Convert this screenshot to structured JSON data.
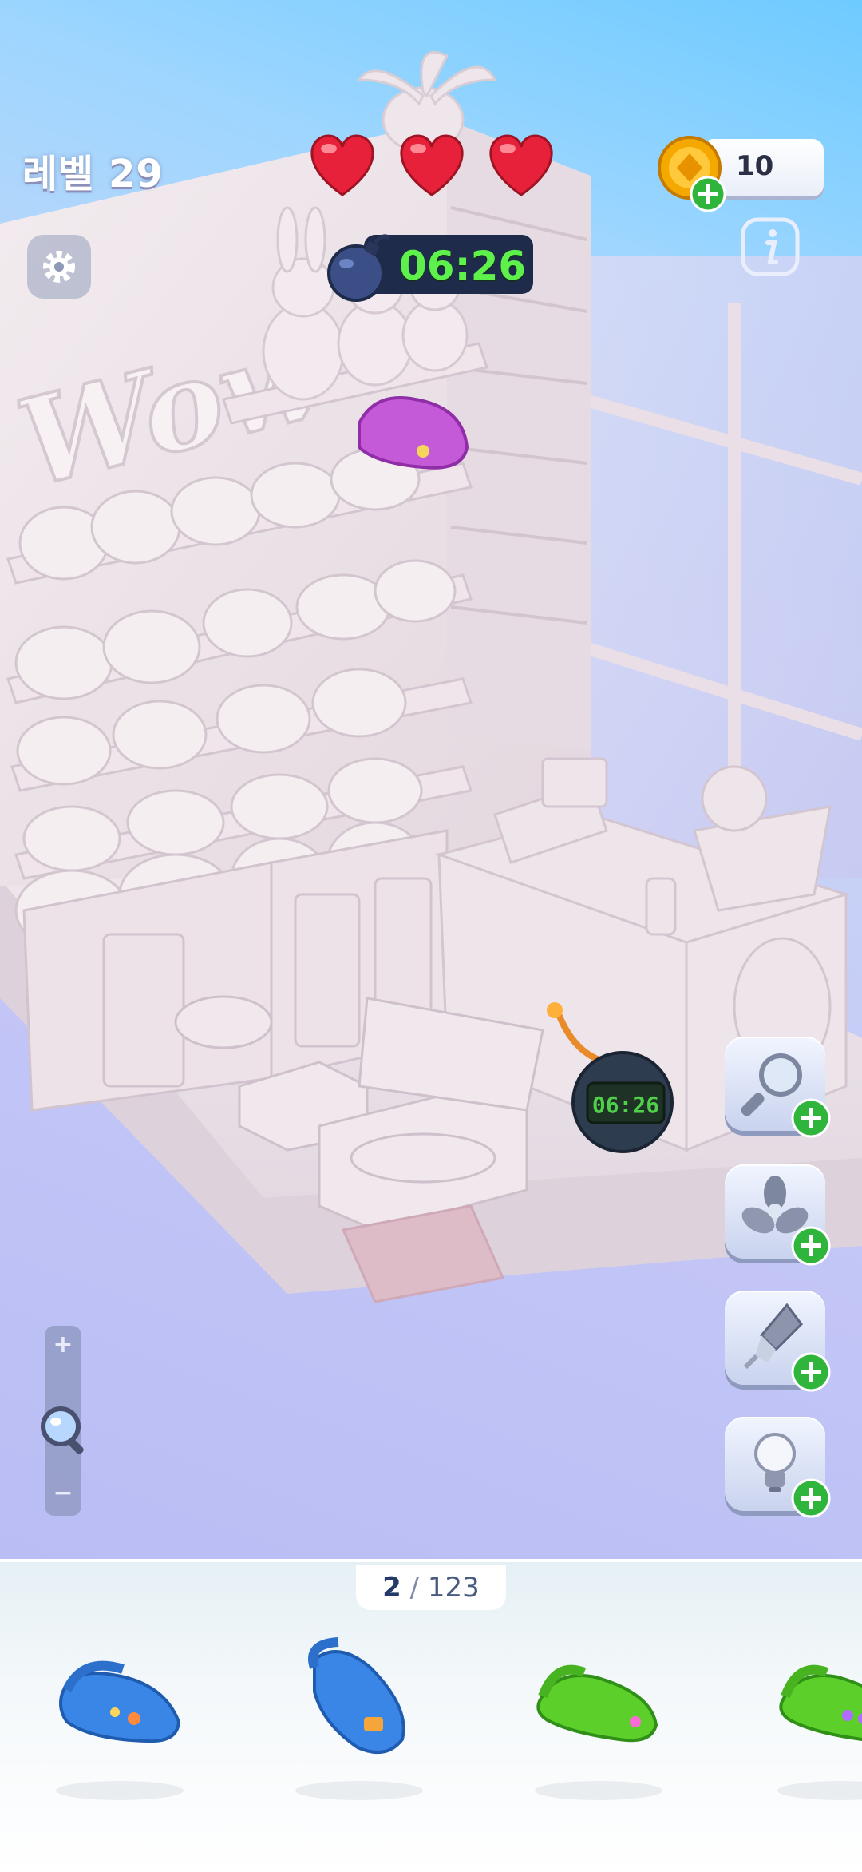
{
  "hud": {
    "level_label": "레벨 29",
    "lives": 3,
    "coins": "10",
    "timer": "06:26"
  },
  "scene": {
    "wall_sign": "Wow",
    "bomb_display": "06:26"
  },
  "powerups": [
    {
      "name": "magnifier"
    },
    {
      "name": "fan"
    },
    {
      "name": "rocket"
    },
    {
      "name": "lightbulb"
    }
  ],
  "zoom": {
    "plus": "+",
    "minus": "−"
  },
  "progress": {
    "found": "2",
    "separator": " / ",
    "total": "123"
  },
  "tray_items": [
    {
      "name": "blue-clog",
      "color": "#3a86e6"
    },
    {
      "name": "blue-clog",
      "color": "#3a86e6"
    },
    {
      "name": "green-clog",
      "color": "#5ccf2b"
    },
    {
      "name": "green-clog",
      "color": "#5ccf2b"
    }
  ],
  "colors": {
    "accent_green": "#5ef04b",
    "heart_red": "#e8213a",
    "coin_gold": "#f5a800",
    "plus_green": "#2fb53c"
  }
}
